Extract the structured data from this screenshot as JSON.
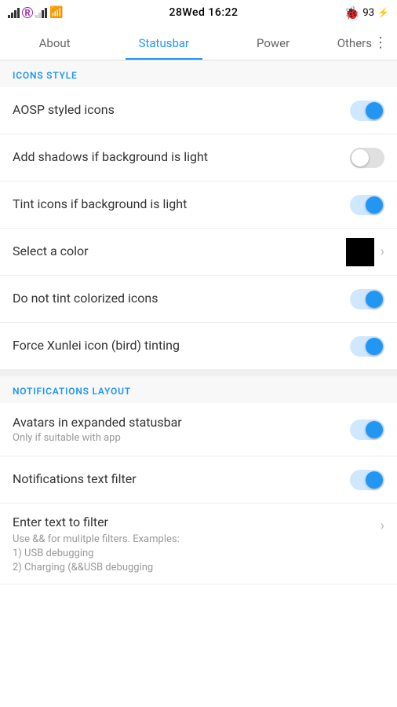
{
  "statusBar": {
    "time": "16:22",
    "date": "28Wed",
    "battery": "93",
    "batteryIcon": "⚡"
  },
  "tabs": [
    {
      "id": "about",
      "label": "About",
      "active": false
    },
    {
      "id": "statusbar",
      "label": "Statusbar",
      "active": true
    },
    {
      "id": "power",
      "label": "Power",
      "active": false
    },
    {
      "id": "others",
      "label": "Others",
      "active": false
    }
  ],
  "sections": [
    {
      "id": "icons-style",
      "header": "ICONS STYLE",
      "rows": [
        {
          "id": "aosp-styled-icons",
          "label": "AOSP styled icons",
          "type": "toggle",
          "state": "on"
        },
        {
          "id": "add-shadows",
          "label": "Add shadows if background is light",
          "type": "toggle",
          "state": "off"
        },
        {
          "id": "tint-icons",
          "label": "Tint icons if background is light",
          "type": "toggle",
          "state": "on"
        },
        {
          "id": "select-color",
          "label": "Select a color",
          "type": "color",
          "color": "#000000"
        },
        {
          "id": "do-not-tint",
          "label": "Do not tint colorized icons",
          "type": "toggle",
          "state": "on"
        },
        {
          "id": "force-xunlei",
          "label": "Force Xunlei icon (bird) tinting",
          "type": "toggle",
          "state": "on"
        }
      ]
    },
    {
      "id": "notifications-layout",
      "header": "NOTIFICATIONS LAYOUT",
      "rows": [
        {
          "id": "avatars-expanded",
          "label": "Avatars in expanded statusbar",
          "sublabel": "Only if suitable with app",
          "type": "toggle",
          "state": "on"
        },
        {
          "id": "notifications-text-filter",
          "label": "Notifications text filter",
          "type": "toggle",
          "state": "on"
        },
        {
          "id": "enter-text-filter",
          "label": "Enter text to filter",
          "type": "description",
          "description": "Use && for mulitple filters. Examples:\n1) USB debugging\n2) Charging (&&USB debugging",
          "hasChevron": true
        }
      ]
    }
  ]
}
